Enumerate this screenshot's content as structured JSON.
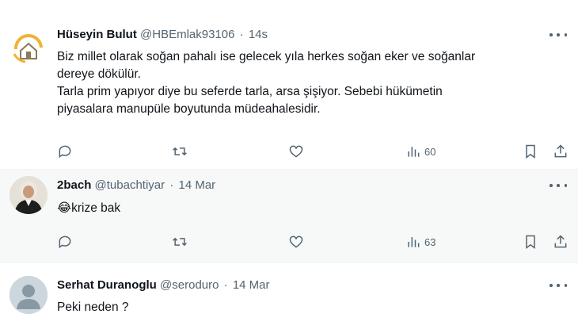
{
  "tweets": [
    {
      "name": "Hüseyin Bulut",
      "handle": "@HBEmlak93106",
      "time": "14s",
      "lines": "Biz millet olarak soğan pahalı ise gelecek yıla herkes soğan eker ve soğanlar\ndereye dökülür.\nTarla prim yapıyor diye bu seferde tarla, arsa şişiyor. Sebebi hükümetin\npiyasalara manupüle boyutunda müdeahalesidir.",
      "views": "60",
      "avatar_icon": "house-logo-icon",
      "avatar_color": "#f2b233"
    },
    {
      "name": "2bach",
      "handle": "@tubachtiyar",
      "time": "14 Mar",
      "emoji": "😂",
      "text": "krize bak",
      "views": "63",
      "avatar_icon": "portrait-icon"
    },
    {
      "name": "Serhat Duranoglu",
      "handle": "@seroduro",
      "time": "14 Mar",
      "text": "Peki neden ?",
      "avatar_icon": "default-user-icon"
    }
  ],
  "separator": "·",
  "colors": {
    "text": "#0f1419",
    "muted": "#536471",
    "highlight_bg": "#f7f9f9"
  }
}
